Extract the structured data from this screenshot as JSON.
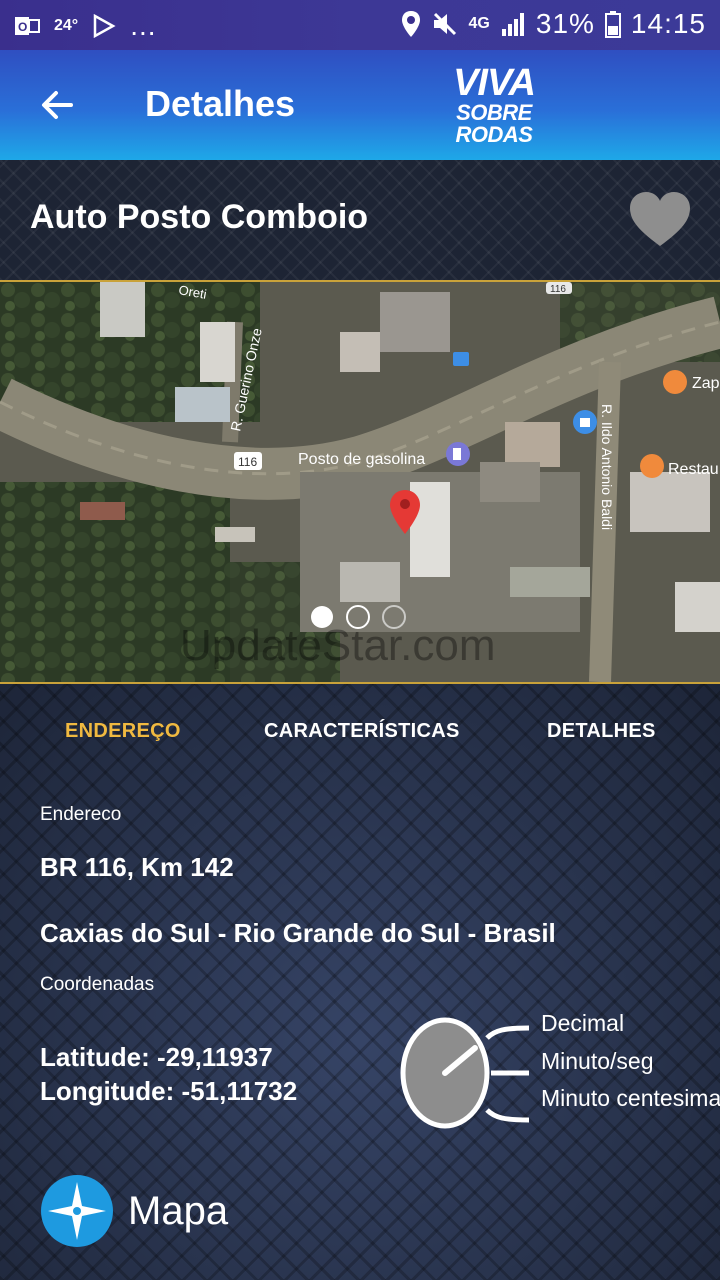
{
  "status_bar": {
    "left_temp": "24°",
    "more": "...",
    "network": "4G",
    "battery": "31%",
    "time": "14:15"
  },
  "app_bar": {
    "title": "Detalhes",
    "logo": {
      "line1": "VIVA",
      "line2": "SOBRE",
      "line3": "RODAS"
    }
  },
  "place": {
    "name": "Auto Posto Comboio"
  },
  "map_image": {
    "labels": {
      "street_left": "R. Guerino Onze",
      "street_right": "R. Ildo Antonio Baldi",
      "road": "116",
      "road2": "116",
      "poi_gas": "Posto de gasolina",
      "poi_right1": "Zap",
      "poi_right2": "Restau",
      "top_street": "Oreti",
      "watermark": "UpdateStar.com"
    },
    "pager": {
      "count": 3,
      "active": 0
    }
  },
  "tabs": [
    {
      "label": "ENDEREÇO",
      "active": true
    },
    {
      "label": "CARACTERÍSTICAS",
      "active": false
    },
    {
      "label": "DETALHES",
      "active": false
    }
  ],
  "address": {
    "label": "Endereco",
    "line1": "BR 116, Km 142",
    "line2": "Caxias do Sul - Rio Grande do Sul - Brasil"
  },
  "coordinates": {
    "label": "Coordenadas",
    "latitude": "Latitude: -29,11937",
    "longitude": "Longitude: -51,11732",
    "formats": [
      "Decimal",
      "Minuto/seg",
      "Minuto centesimal"
    ]
  },
  "map_button": {
    "label": "Mapa"
  },
  "colors": {
    "accent": "#f0b940",
    "appbar_top": "#2f4fc1",
    "appbar_bottom": "#1ea8e8",
    "status_bar": "#3a2f8d",
    "divider": "#c9a23a",
    "compass": "#1e9ae0"
  }
}
